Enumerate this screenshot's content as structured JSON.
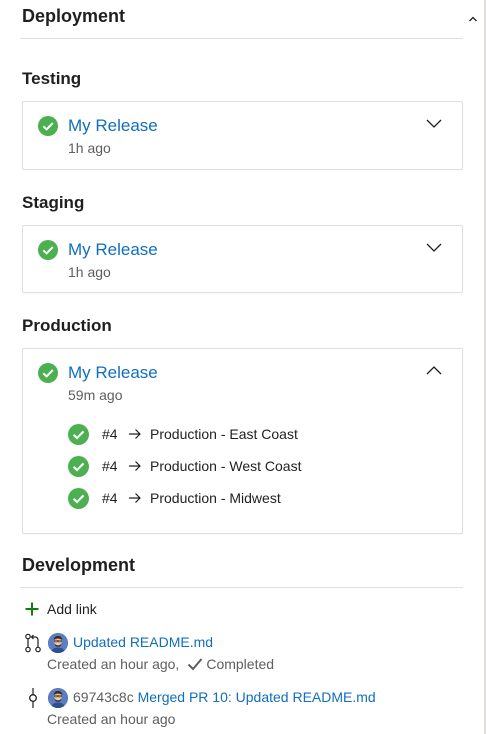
{
  "deployment": {
    "title": "Deployment",
    "stages": [
      {
        "label": "Testing",
        "release": {
          "name": "My Release",
          "time": "1h ago",
          "expanded": false,
          "status": "succeeded"
        }
      },
      {
        "label": "Staging",
        "release": {
          "name": "My Release",
          "time": "1h ago",
          "expanded": false,
          "status": "succeeded"
        }
      },
      {
        "label": "Production",
        "release": {
          "name": "My Release",
          "time": "59m ago",
          "expanded": true,
          "status": "succeeded",
          "deployments": [
            {
              "number": "#4",
              "target": "Production - East Coast",
              "status": "succeeded"
            },
            {
              "number": "#4",
              "target": "Production - West Coast",
              "status": "succeeded"
            },
            {
              "number": "#4",
              "target": "Production - Midwest",
              "status": "succeeded"
            }
          ]
        }
      }
    ]
  },
  "development": {
    "title": "Development",
    "add_link_label": "Add link",
    "items": [
      {
        "type_icon": "pull-request-icon",
        "hash": "",
        "title": "Updated README.md",
        "created": "Created an hour ago,",
        "status": "Completed"
      },
      {
        "type_icon": "commit-icon",
        "hash": "69743c8c",
        "title": "Merged PR 10: Updated README.md",
        "created": "Created an hour ago",
        "status": ""
      }
    ]
  },
  "colors": {
    "success": "#4caf50",
    "link": "#106ebe",
    "add": "#107c10",
    "muted": "#605e5c",
    "border": "#e1dfdd"
  }
}
